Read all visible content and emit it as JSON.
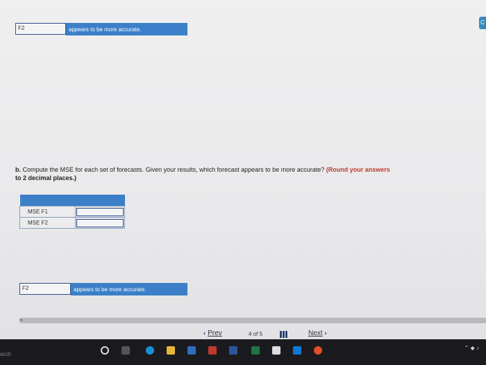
{
  "top_answer": {
    "select_value": "F2",
    "text": "appears to be more accurate."
  },
  "question": {
    "lead": "b.",
    "text": "Compute the MSE for each set of forecasts. Given your results, which forecast appears to be more accurate?",
    "hint": "(Round your answers",
    "hint_cont": "to 2 decimal places.)"
  },
  "mse_table": {
    "rows": [
      {
        "label": "MSE F1",
        "value": ""
      },
      {
        "label": "MSE F2",
        "value": ""
      }
    ]
  },
  "bottom_answer": {
    "select_value": "F2",
    "text": "appears to be more accurate."
  },
  "nav": {
    "prev": "Prev",
    "page_current": "4",
    "page_of": "of",
    "page_total": "5",
    "next": "Next"
  },
  "side_tab": "C",
  "taskbar": {
    "search_text": "arch"
  },
  "colors": {
    "accent": "#3b7fc8",
    "nav_chevron": "#2d4f8a",
    "hint": "#c0392b"
  }
}
